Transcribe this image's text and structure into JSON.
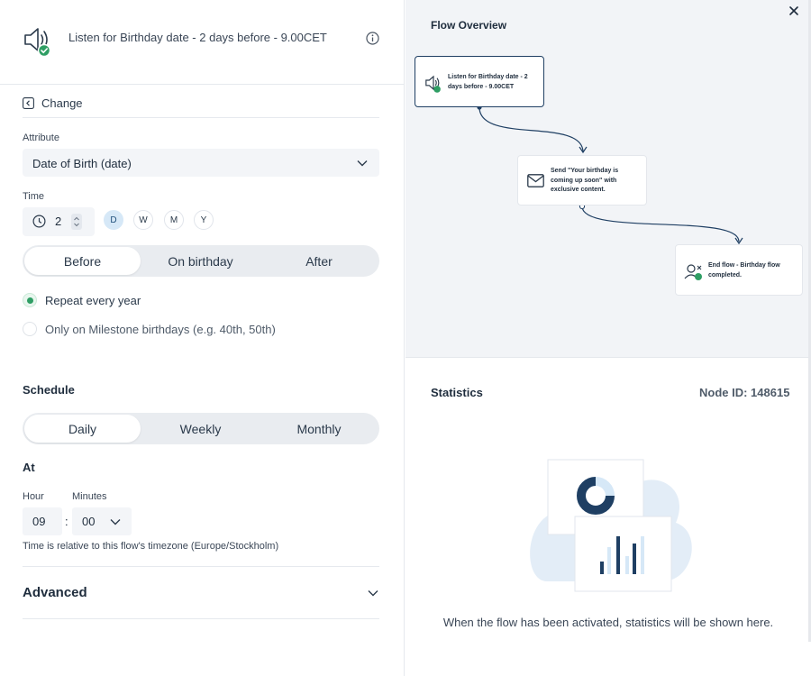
{
  "trigger": {
    "title": "Listen for Birthday date - 2 days before - 9.00CET"
  },
  "change_label": "Change",
  "attribute": {
    "label": "Attribute",
    "value": "Date of Birth (date)"
  },
  "time": {
    "label": "Time",
    "amount": "2",
    "units": [
      "D",
      "W",
      "M",
      "Y"
    ],
    "selected_unit": "D"
  },
  "relative": {
    "options": [
      "Before",
      "On birthday",
      "After"
    ],
    "selected": "Before"
  },
  "repeat": {
    "options": [
      {
        "label": "Repeat every year",
        "selected": true
      },
      {
        "label": "Only on Milestone birthdays (e.g. 40th, 50th)",
        "selected": false
      }
    ]
  },
  "schedule": {
    "title": "Schedule",
    "options": [
      "Daily",
      "Weekly",
      "Monthly"
    ],
    "selected": "Daily"
  },
  "at": {
    "title": "At",
    "hour_label": "Hour",
    "minutes_label": "Minutes",
    "hour": "09",
    "separator": ":",
    "minutes": "00",
    "note": "Time is relative to this flow's timezone (Europe/Stockholm)"
  },
  "advanced": {
    "title": "Advanced"
  },
  "flow": {
    "title": "Flow Overview",
    "nodes": [
      {
        "text": "Listen for Birthday date - 2 days before - 9.00CET",
        "icon": "speaker-icon"
      },
      {
        "text": "Send \"Your birthday is coming up soon\" with exclusive content.",
        "icon": "envelope-icon"
      },
      {
        "text": "End flow - Birthday flow completed.",
        "icon": "user-end-icon"
      }
    ]
  },
  "stats": {
    "title": "Statistics",
    "node_id": "Node ID: 148615",
    "message": "When the flow has been activated, statistics will be shown here."
  },
  "colors": {
    "accent_green": "#2f9e64",
    "navy": "#1f3f63",
    "light_blue": "#d6e8f7",
    "panel_grey": "#f2f4f7"
  }
}
